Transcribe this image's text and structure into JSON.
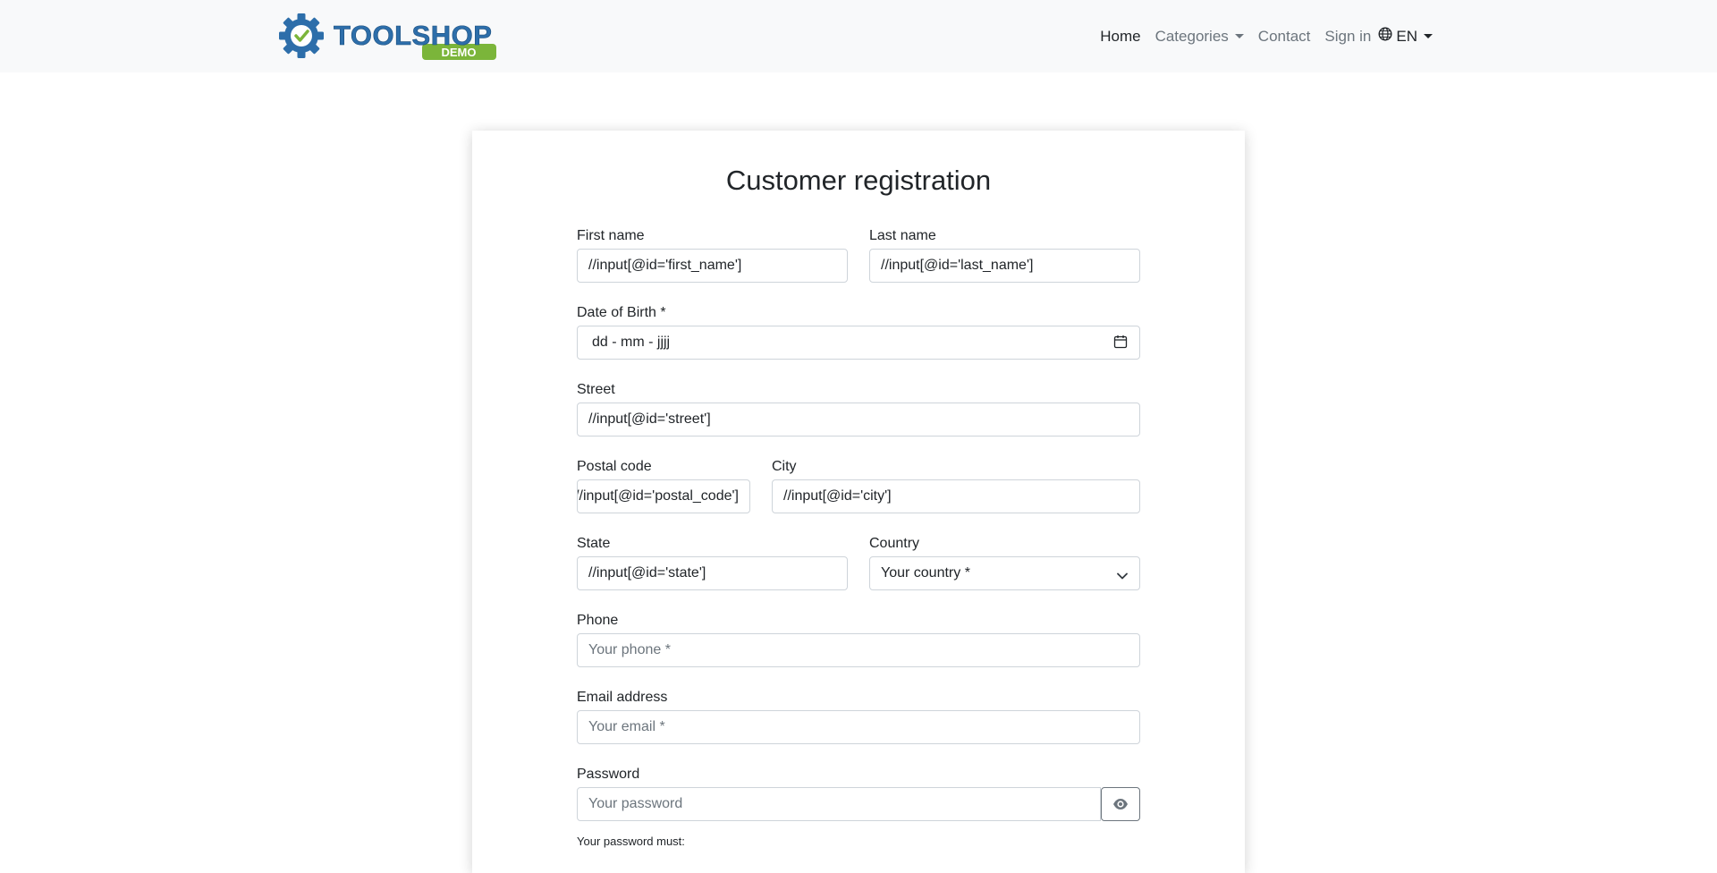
{
  "navbar": {
    "logo": {
      "text_main": "TOOLSHOP",
      "text_badge": "DEMO"
    },
    "links": {
      "home": "Home",
      "categories": "Categories",
      "contact": "Contact",
      "signin": "Sign in",
      "language": "EN"
    }
  },
  "form": {
    "title": "Customer registration",
    "first_name": {
      "label": "First name",
      "value": "//input[@id='first_name']"
    },
    "last_name": {
      "label": "Last name",
      "value": "//input[@id='last_name']"
    },
    "dob": {
      "label": "Date of Birth *",
      "value": "dd - mm - jjjj"
    },
    "street": {
      "label": "Street",
      "value": "//input[@id='street']"
    },
    "postal_code": {
      "label": "Postal code",
      "value": "//input[@id='postal_code']"
    },
    "city": {
      "label": "City",
      "value": "//input[@id='city']"
    },
    "state": {
      "label": "State",
      "value": "//input[@id='state']"
    },
    "country": {
      "label": "Country",
      "selected": "Your country *"
    },
    "phone": {
      "label": "Phone",
      "placeholder": "Your phone *"
    },
    "email": {
      "label": "Email address",
      "placeholder": "Your email *"
    },
    "password": {
      "label": "Password",
      "placeholder": "Your password",
      "hint": "Your password must:"
    }
  },
  "colors": {
    "navbar_bg": "#f8f9fa",
    "logo_blue": "#2d6eaa",
    "logo_green": "#7bb53a",
    "input_border": "#ced4da",
    "muted_text": "#6c757d"
  },
  "icons": {
    "logo": "gear-check-icon",
    "language": "globe-icon",
    "dob": "calendar-icon",
    "country": "chevron-down-icon",
    "password": "eye-icon"
  }
}
